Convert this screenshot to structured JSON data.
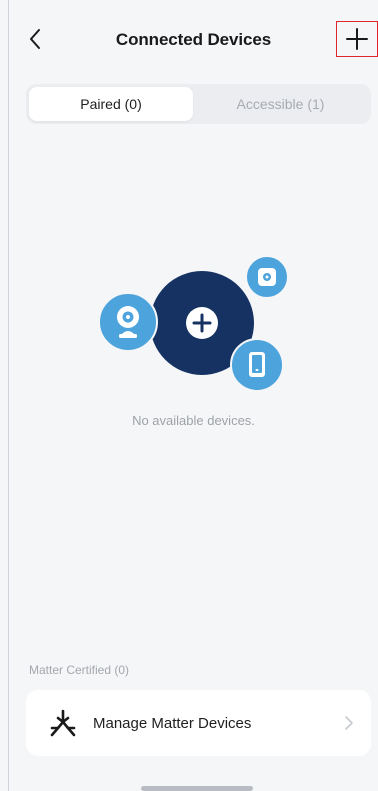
{
  "header": {
    "title": "Connected Devices",
    "back_icon": "chevron-left-icon",
    "add_icon": "plus-icon"
  },
  "tabs": [
    {
      "label": "Paired (0)",
      "active": true
    },
    {
      "label": "Accessible (1)",
      "active": false
    }
  ],
  "empty_state": {
    "message": "No available devices.",
    "icons": [
      "camera-icon",
      "plus-icon",
      "sensor-icon",
      "phone-icon"
    ]
  },
  "matter": {
    "section_label": "Matter Certified (0)",
    "manage_label": "Manage Matter Devices",
    "icon": "matter-logo-icon",
    "chevron_icon": "chevron-right-icon"
  },
  "colors": {
    "accent_dark": "#163262",
    "accent_light": "#4da3dc",
    "highlight_border": "#e0252e",
    "background": "#f5f6f8"
  }
}
